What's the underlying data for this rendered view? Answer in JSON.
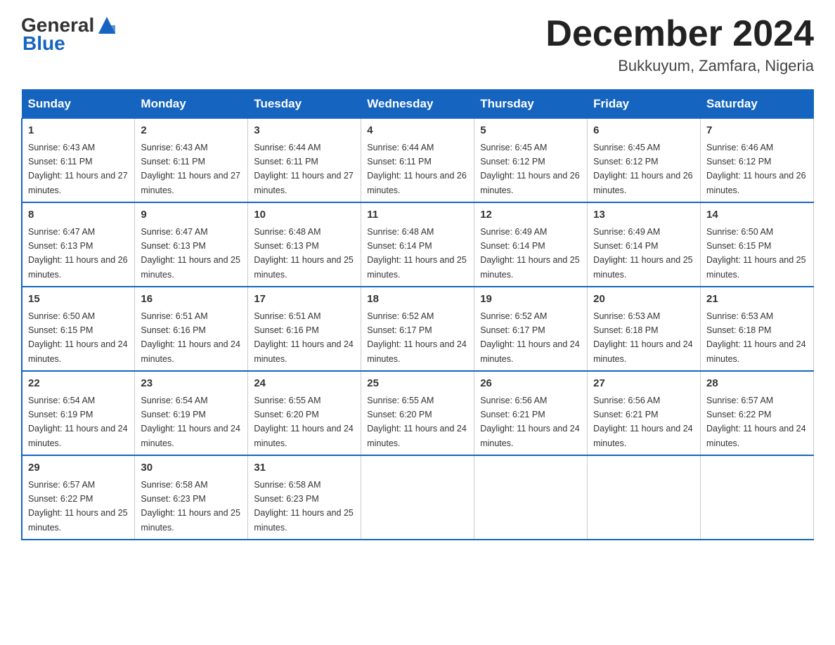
{
  "logo": {
    "general": "General",
    "blue": "Blue"
  },
  "title": "December 2024",
  "location": "Bukkuyum, Zamfara, Nigeria",
  "headers": [
    "Sunday",
    "Monday",
    "Tuesday",
    "Wednesday",
    "Thursday",
    "Friday",
    "Saturday"
  ],
  "weeks": [
    [
      {
        "day": "1",
        "sunrise": "6:43 AM",
        "sunset": "6:11 PM",
        "daylight": "11 hours and 27 minutes."
      },
      {
        "day": "2",
        "sunrise": "6:43 AM",
        "sunset": "6:11 PM",
        "daylight": "11 hours and 27 minutes."
      },
      {
        "day": "3",
        "sunrise": "6:44 AM",
        "sunset": "6:11 PM",
        "daylight": "11 hours and 27 minutes."
      },
      {
        "day": "4",
        "sunrise": "6:44 AM",
        "sunset": "6:11 PM",
        "daylight": "11 hours and 26 minutes."
      },
      {
        "day": "5",
        "sunrise": "6:45 AM",
        "sunset": "6:12 PM",
        "daylight": "11 hours and 26 minutes."
      },
      {
        "day": "6",
        "sunrise": "6:45 AM",
        "sunset": "6:12 PM",
        "daylight": "11 hours and 26 minutes."
      },
      {
        "day": "7",
        "sunrise": "6:46 AM",
        "sunset": "6:12 PM",
        "daylight": "11 hours and 26 minutes."
      }
    ],
    [
      {
        "day": "8",
        "sunrise": "6:47 AM",
        "sunset": "6:13 PM",
        "daylight": "11 hours and 26 minutes."
      },
      {
        "day": "9",
        "sunrise": "6:47 AM",
        "sunset": "6:13 PM",
        "daylight": "11 hours and 25 minutes."
      },
      {
        "day": "10",
        "sunrise": "6:48 AM",
        "sunset": "6:13 PM",
        "daylight": "11 hours and 25 minutes."
      },
      {
        "day": "11",
        "sunrise": "6:48 AM",
        "sunset": "6:14 PM",
        "daylight": "11 hours and 25 minutes."
      },
      {
        "day": "12",
        "sunrise": "6:49 AM",
        "sunset": "6:14 PM",
        "daylight": "11 hours and 25 minutes."
      },
      {
        "day": "13",
        "sunrise": "6:49 AM",
        "sunset": "6:14 PM",
        "daylight": "11 hours and 25 minutes."
      },
      {
        "day": "14",
        "sunrise": "6:50 AM",
        "sunset": "6:15 PM",
        "daylight": "11 hours and 25 minutes."
      }
    ],
    [
      {
        "day": "15",
        "sunrise": "6:50 AM",
        "sunset": "6:15 PM",
        "daylight": "11 hours and 24 minutes."
      },
      {
        "day": "16",
        "sunrise": "6:51 AM",
        "sunset": "6:16 PM",
        "daylight": "11 hours and 24 minutes."
      },
      {
        "day": "17",
        "sunrise": "6:51 AM",
        "sunset": "6:16 PM",
        "daylight": "11 hours and 24 minutes."
      },
      {
        "day": "18",
        "sunrise": "6:52 AM",
        "sunset": "6:17 PM",
        "daylight": "11 hours and 24 minutes."
      },
      {
        "day": "19",
        "sunrise": "6:52 AM",
        "sunset": "6:17 PM",
        "daylight": "11 hours and 24 minutes."
      },
      {
        "day": "20",
        "sunrise": "6:53 AM",
        "sunset": "6:18 PM",
        "daylight": "11 hours and 24 minutes."
      },
      {
        "day": "21",
        "sunrise": "6:53 AM",
        "sunset": "6:18 PM",
        "daylight": "11 hours and 24 minutes."
      }
    ],
    [
      {
        "day": "22",
        "sunrise": "6:54 AM",
        "sunset": "6:19 PM",
        "daylight": "11 hours and 24 minutes."
      },
      {
        "day": "23",
        "sunrise": "6:54 AM",
        "sunset": "6:19 PM",
        "daylight": "11 hours and 24 minutes."
      },
      {
        "day": "24",
        "sunrise": "6:55 AM",
        "sunset": "6:20 PM",
        "daylight": "11 hours and 24 minutes."
      },
      {
        "day": "25",
        "sunrise": "6:55 AM",
        "sunset": "6:20 PM",
        "daylight": "11 hours and 24 minutes."
      },
      {
        "day": "26",
        "sunrise": "6:56 AM",
        "sunset": "6:21 PM",
        "daylight": "11 hours and 24 minutes."
      },
      {
        "day": "27",
        "sunrise": "6:56 AM",
        "sunset": "6:21 PM",
        "daylight": "11 hours and 24 minutes."
      },
      {
        "day": "28",
        "sunrise": "6:57 AM",
        "sunset": "6:22 PM",
        "daylight": "11 hours and 24 minutes."
      }
    ],
    [
      {
        "day": "29",
        "sunrise": "6:57 AM",
        "sunset": "6:22 PM",
        "daylight": "11 hours and 25 minutes."
      },
      {
        "day": "30",
        "sunrise": "6:58 AM",
        "sunset": "6:23 PM",
        "daylight": "11 hours and 25 minutes."
      },
      {
        "day": "31",
        "sunrise": "6:58 AM",
        "sunset": "6:23 PM",
        "daylight": "11 hours and 25 minutes."
      },
      null,
      null,
      null,
      null
    ]
  ]
}
